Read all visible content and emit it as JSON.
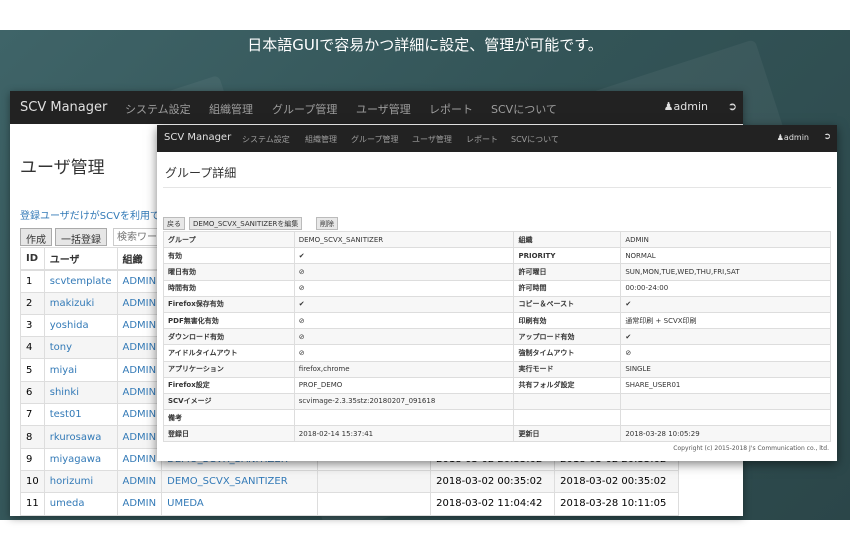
{
  "banner": {
    "tagline": "日本語GUIで容易かつ詳細に設定、管理が可能です。"
  },
  "back_window": {
    "brand": "SCV Manager",
    "nav": [
      "システム設定",
      "組織管理",
      "グループ管理",
      "ユーザ管理",
      "レポート",
      "SCVについて"
    ],
    "user": "admin",
    "title": "ユーザ管理",
    "description": "登録ユーザだけがSCVを利用で",
    "buttons": [
      "作成",
      "一括登録"
    ],
    "search_placeholder": "検索ワー",
    "columns": [
      "ID",
      "ユーザ",
      "組織"
    ],
    "rows": [
      {
        "id": "1",
        "user": "scvtemplate",
        "org": "ADMIN",
        "group": "",
        "created": "",
        "updated": ""
      },
      {
        "id": "2",
        "user": "makizuki",
        "org": "ADMIN",
        "group": "",
        "created": "",
        "updated": ""
      },
      {
        "id": "3",
        "user": "yoshida",
        "org": "ADMIN",
        "group": "",
        "created": "",
        "updated": ""
      },
      {
        "id": "4",
        "user": "tony",
        "org": "ADMIN",
        "group": "",
        "created": "",
        "updated": ""
      },
      {
        "id": "5",
        "user": "miyai",
        "org": "ADMIN",
        "group": "",
        "created": "",
        "updated": ""
      },
      {
        "id": "6",
        "user": "shinki",
        "org": "ADMIN",
        "group": "",
        "created": "",
        "updated": ""
      },
      {
        "id": "7",
        "user": "test01",
        "org": "ADMIN",
        "group": "",
        "created": "",
        "updated": ""
      },
      {
        "id": "8",
        "user": "rkurosawa",
        "org": "ADMIN",
        "group": "",
        "created": "",
        "updated": ""
      },
      {
        "id": "9",
        "user": "miyagawa",
        "org": "ADMIN",
        "group": "DEMO_SCVX_SANITIZER",
        "created": "2018-03-02 20:35:02",
        "updated": "2018-03-02 20:35:02"
      },
      {
        "id": "10",
        "user": "horizumi",
        "org": "ADMIN",
        "group": "DEMO_SCVX_SANITIZER",
        "created": "2018-03-02 00:35:02",
        "updated": "2018-03-02 00:35:02"
      },
      {
        "id": "11",
        "user": "umeda",
        "org": "ADMIN",
        "group": "UMEDA",
        "created": "2018-03-02 11:04:42",
        "updated": "2018-03-28 10:11:05"
      }
    ]
  },
  "front_window": {
    "brand": "SCV Manager",
    "nav": [
      "システム設定",
      "組織管理",
      "グループ管理",
      "ユーザ管理",
      "レポート",
      "SCVについて"
    ],
    "user": "admin",
    "title": "グループ詳細",
    "buttons": [
      "戻る",
      "DEMO_SCVX_SANITIZERを編集",
      "削除"
    ],
    "rows": [
      {
        "l1": "グループ",
        "v1": "DEMO_SCVX_SANITIZER",
        "l2": "組織",
        "v2": "ADMIN"
      },
      {
        "l1": "有効",
        "v1": "✔",
        "l2": "PRIORITY",
        "v2": "NORMAL"
      },
      {
        "l1": "曜日有効",
        "v1": "⊘",
        "l2": "許可曜日",
        "v2": "SUN,MON,TUE,WED,THU,FRI,SAT"
      },
      {
        "l1": "時間有効",
        "v1": "⊘",
        "l2": "許可時間",
        "v2": "00:00-24:00"
      },
      {
        "l1": "Firefox保存有効",
        "v1": "✔",
        "l2": "コピー＆ペースト",
        "v2": "✔"
      },
      {
        "l1": "PDF無害化有効",
        "v1": "⊘",
        "l2": "印刷有効",
        "v2": "通常印刷 + SCVX印刷"
      },
      {
        "l1": "ダウンロード有効",
        "v1": "⊘",
        "l2": "アップロード有効",
        "v2": "✔"
      },
      {
        "l1": "アイドルタイムアウト",
        "v1": "⊘",
        "l2": "強制タイムアウト",
        "v2": "⊘"
      },
      {
        "l1": "アプリケーション",
        "v1": "firefox,chrome",
        "l2": "実行モード",
        "v2": "SINGLE"
      },
      {
        "l1": "Firefox設定",
        "v1": "PROF_DEMO",
        "l2": "共有フォルダ設定",
        "v2": "SHARE_USER01"
      },
      {
        "l1": "SCVイメージ",
        "v1": "scvimage-2.3.35stz:20180207_091618",
        "l2": "",
        "v2": ""
      },
      {
        "l1": "備考",
        "v1": "",
        "l2": "",
        "v2": ""
      },
      {
        "l1": "登録日",
        "v1": "2018-02-14 15:37:41",
        "l2": "更新日",
        "v2": "2018-03-28 10:05:29"
      }
    ],
    "footer": "Copyright (c) 2015-2018 J's Communication co., ltd."
  }
}
